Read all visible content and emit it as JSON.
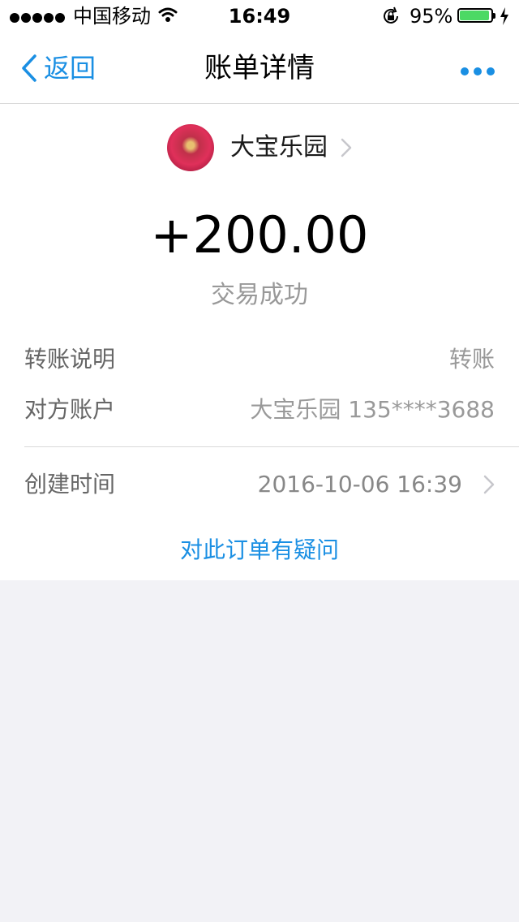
{
  "status_bar": {
    "carrier": "中国移动",
    "time": "16:49",
    "battery_percent": "95%",
    "battery_level": 0.95,
    "icons": [
      "signal-dots-icon",
      "wifi-icon",
      "rotation-lock-icon",
      "battery-icon",
      "charging-icon"
    ]
  },
  "nav": {
    "back_label": "返回",
    "title": "账单详情",
    "more_icon": "more-dots-icon",
    "accent_color": "#1a8fe3"
  },
  "bill": {
    "counterparty_name": "大宝乐园",
    "amount": "+200.00",
    "status": "交易成功",
    "details": [
      {
        "label": "转账说明",
        "value": "转账"
      },
      {
        "label": "对方账户",
        "value": "大宝乐园 135****3688"
      }
    ],
    "created": {
      "label": "创建时间",
      "value": "2016-10-06 16:39"
    },
    "question_link": "对此订单有疑问"
  }
}
